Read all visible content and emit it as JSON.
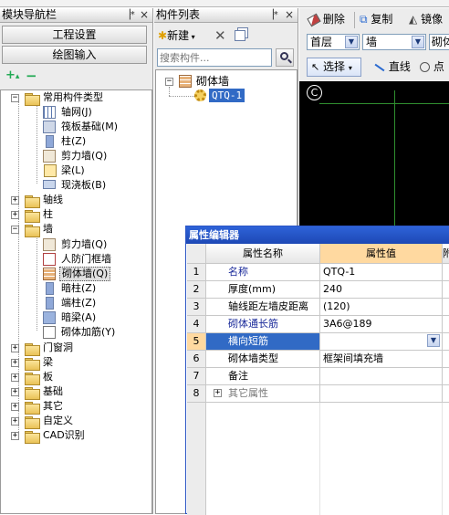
{
  "left_panel": {
    "title": "模块导航栏",
    "pin": "ᵽ",
    "close": "×",
    "btn_engineering": "工程设置",
    "btn_drawing": "绘图输入",
    "tree": {
      "common": "常用构件类型",
      "common_items": [
        "轴网(J)",
        "筏板基础(M)",
        "柱(Z)",
        "剪力墙(Q)",
        "梁(L)",
        "现浇板(B)"
      ],
      "axis": "轴线",
      "column": "柱",
      "wall": "墙",
      "wall_items": [
        "剪力墙(Q)",
        "人防门框墙",
        "砌体墙(Q)",
        "暗柱(Z)",
        "端柱(Z)",
        "暗梁(A)",
        "砌体加筋(Y)"
      ],
      "rest": [
        "门窗洞",
        "梁",
        "板",
        "基础",
        "其它",
        "自定义",
        "CAD识别"
      ]
    }
  },
  "middle_panel": {
    "title": "构件列表",
    "new_btn": "新建",
    "search_placeholder": "搜索构件...",
    "tree_root": "砌体墙",
    "tree_child": "QTQ-1"
  },
  "right_toolbar": {
    "delete": "删除",
    "copy": "复制",
    "mirror": "镜像",
    "floor": "首层",
    "type": "墙",
    "sub": "砌体",
    "select": "选择",
    "line": "直线",
    "point": "点"
  },
  "property_editor": {
    "title": "属性编辑器",
    "col_name": "属性名称",
    "col_value": "属性值",
    "col_extra": "附",
    "rows": [
      {
        "idx": "1",
        "name": "名称",
        "value": "QTQ-1",
        "blue": true
      },
      {
        "idx": "2",
        "name": "厚度(mm)",
        "value": "240",
        "blue": false
      },
      {
        "idx": "3",
        "name": "轴线距左墙皮距离",
        "value": "(120)",
        "blue": false
      },
      {
        "idx": "4",
        "name": "砌体通长筋",
        "value": "3A6@189",
        "blue": true
      },
      {
        "idx": "5",
        "name": "横向短筋",
        "value": "",
        "blue": true
      },
      {
        "idx": "6",
        "name": "砌体墙类型",
        "value": "框架间填充墙",
        "blue": false
      },
      {
        "idx": "7",
        "name": "备注",
        "value": "",
        "blue": false
      },
      {
        "idx": "8",
        "name": "其它属性",
        "value": "",
        "blue": false
      }
    ]
  },
  "colors": {
    "selection": "#316ac5",
    "header_value": "#ffd9a0",
    "prop_title": "#2b55c4",
    "canvas": "#000000",
    "canvas_line": "#1f6e1f"
  }
}
